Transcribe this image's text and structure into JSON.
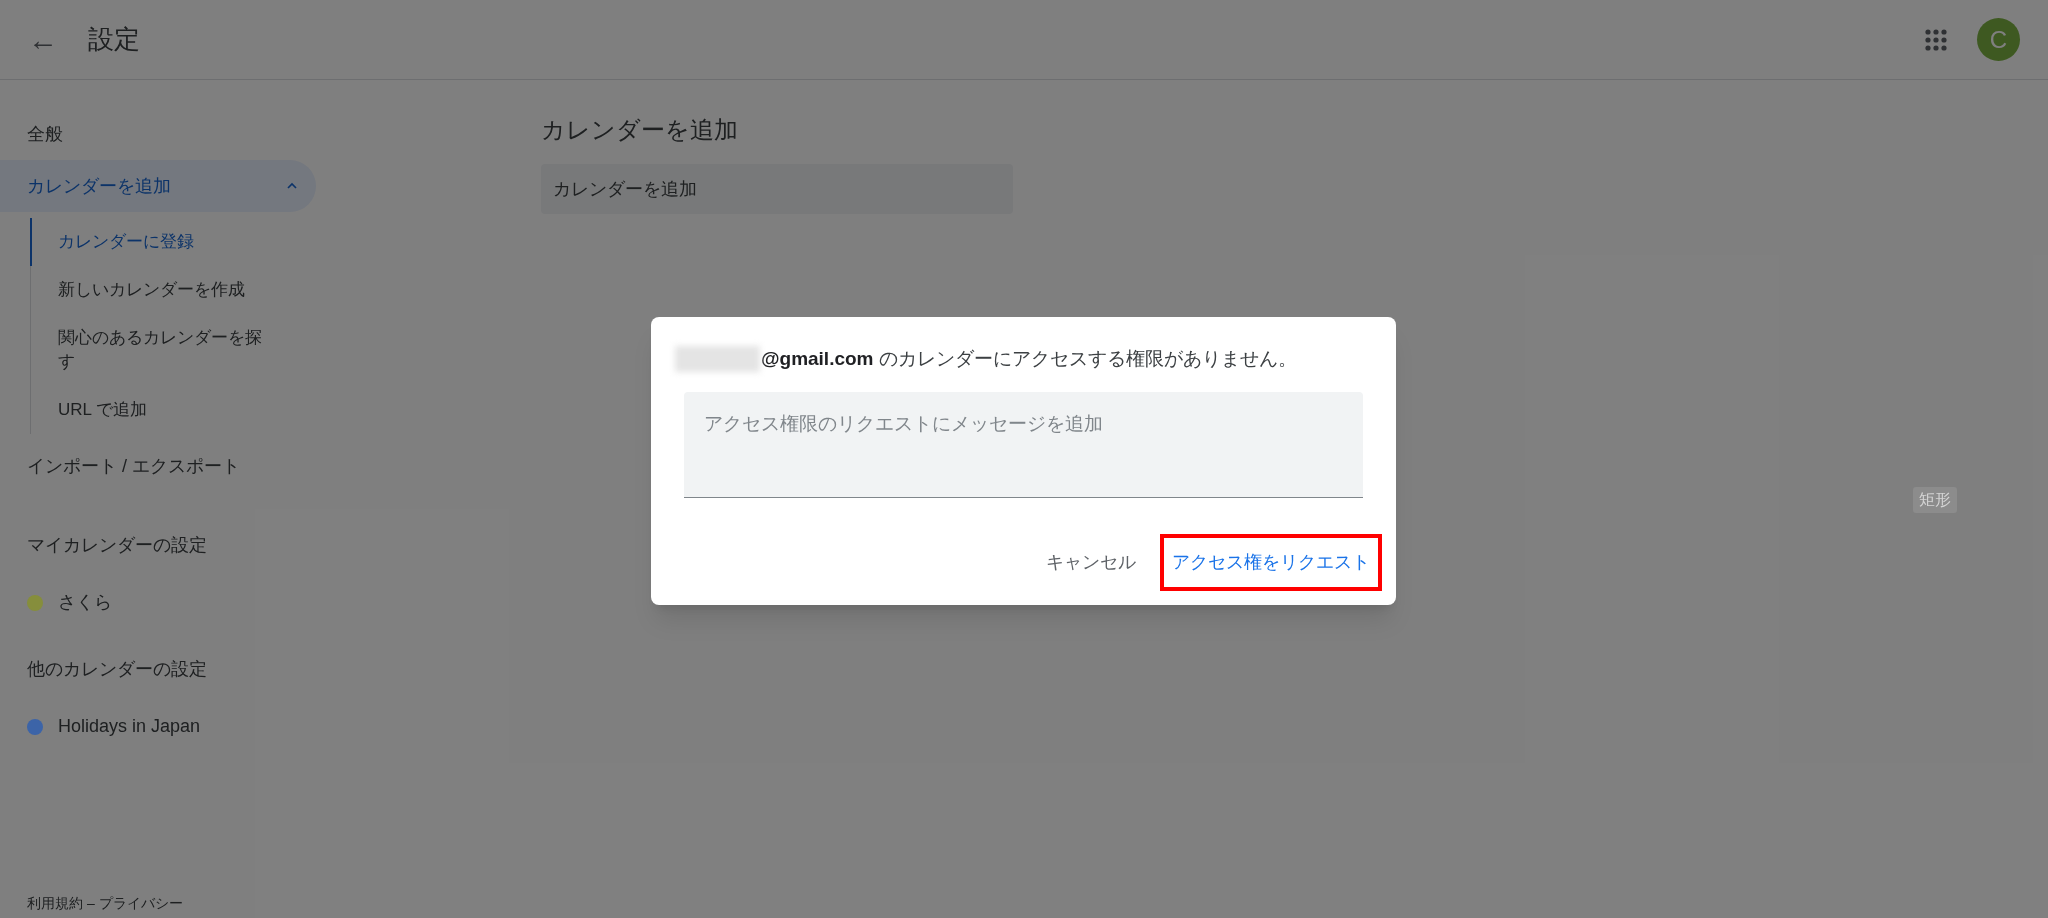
{
  "header": {
    "back_icon": "←",
    "title": "設定",
    "avatar": "C"
  },
  "sidebar": {
    "items": [
      {
        "label": "全般",
        "selected": false
      },
      {
        "label": "カレンダーを追加",
        "selected": true,
        "expanded": true,
        "children": [
          {
            "label": "カレンダーに登録",
            "selected": true
          },
          {
            "label": "新しいカレンダーを作成",
            "selected": false
          },
          {
            "label": "関心のあるカレンダーを探す",
            "selected": false
          },
          {
            "label": "URL で追加",
            "selected": false
          }
        ]
      },
      {
        "label": "インポート / エクスポート",
        "selected": false
      }
    ],
    "sections": [
      {
        "title": "マイカレンダーの設定",
        "calendars": [
          {
            "name": "さくら",
            "color": "#868e3c"
          }
        ]
      },
      {
        "title": "他のカレンダーの設定",
        "calendars": [
          {
            "name": "Holidays in Japan",
            "color": "#3c64a8"
          }
        ]
      }
    ],
    "footer": "利用規約 – プライバシー"
  },
  "main": {
    "heading": "カレンダーを追加",
    "field": {
      "value": "カレンダーを追加"
    },
    "tag": "矩形"
  },
  "dialog": {
    "email": "@gmail.com",
    "message": " のカレンダーにアクセスする権限がありません。",
    "input": {
      "placeholder": "アクセス権限のリクエストにメッセージを追加"
    },
    "buttons": [
      {
        "label": "キャンセル",
        "kind": "text",
        "highlighted": false
      },
      {
        "label": "アクセス権をリクエスト",
        "kind": "primary",
        "highlighted": true
      }
    ]
  }
}
